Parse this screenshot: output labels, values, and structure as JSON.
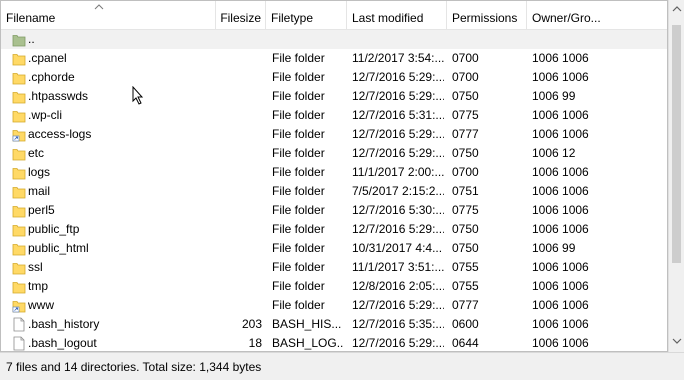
{
  "columns": {
    "filename": "Filename",
    "filesize": "Filesize",
    "filetype": "Filetype",
    "lastmodified": "Last modified",
    "permissions": "Permissions",
    "owner": "Owner/Gro..."
  },
  "icons": {
    "up": "parent-folder-icon",
    "folder": "folder-icon",
    "link": "folder-link-icon",
    "file": "file-icon"
  },
  "colors": {
    "folder": "#ffd966",
    "selection": "#f1f1f1",
    "up_folder": "#a9c08f"
  },
  "files": [
    {
      "name": "..",
      "size": "",
      "type": "",
      "modified": "",
      "perms": "",
      "owner": "",
      "icon": "up",
      "selected": true
    },
    {
      "name": ".cpanel",
      "size": "",
      "type": "File folder",
      "modified": "11/2/2017 3:54:...",
      "perms": "0700",
      "owner": "1006 1006",
      "icon": "folder"
    },
    {
      "name": ".cphorde",
      "size": "",
      "type": "File folder",
      "modified": "12/7/2016 5:29:...",
      "perms": "0700",
      "owner": "1006 1006",
      "icon": "folder"
    },
    {
      "name": ".htpasswds",
      "size": "",
      "type": "File folder",
      "modified": "12/7/2016 5:29:...",
      "perms": "0750",
      "owner": "1006 99",
      "icon": "folder"
    },
    {
      "name": ".wp-cli",
      "size": "",
      "type": "File folder",
      "modified": "12/7/2016 5:31:...",
      "perms": "0775",
      "owner": "1006 1006",
      "icon": "folder"
    },
    {
      "name": "access-logs",
      "size": "",
      "type": "File folder",
      "modified": "12/7/2016 5:29:...",
      "perms": "0777",
      "owner": "1006 1006",
      "icon": "link"
    },
    {
      "name": "etc",
      "size": "",
      "type": "File folder",
      "modified": "12/7/2016 5:29:...",
      "perms": "0750",
      "owner": "1006 12",
      "icon": "folder"
    },
    {
      "name": "logs",
      "size": "",
      "type": "File folder",
      "modified": "11/1/2017 2:00:...",
      "perms": "0700",
      "owner": "1006 1006",
      "icon": "folder"
    },
    {
      "name": "mail",
      "size": "",
      "type": "File folder",
      "modified": "7/5/2017 2:15:2...",
      "perms": "0751",
      "owner": "1006 1006",
      "icon": "folder"
    },
    {
      "name": "perl5",
      "size": "",
      "type": "File folder",
      "modified": "12/7/2016 5:30:...",
      "perms": "0775",
      "owner": "1006 1006",
      "icon": "folder"
    },
    {
      "name": "public_ftp",
      "size": "",
      "type": "File folder",
      "modified": "12/7/2016 5:29:...",
      "perms": "0750",
      "owner": "1006 1006",
      "icon": "folder"
    },
    {
      "name": "public_html",
      "size": "",
      "type": "File folder",
      "modified": "10/31/2017 4:4...",
      "perms": "0750",
      "owner": "1006 99",
      "icon": "folder"
    },
    {
      "name": "ssl",
      "size": "",
      "type": "File folder",
      "modified": "11/1/2017 3:51:...",
      "perms": "0755",
      "owner": "1006 1006",
      "icon": "folder"
    },
    {
      "name": "tmp",
      "size": "",
      "type": "File folder",
      "modified": "12/8/2016 2:05:...",
      "perms": "0755",
      "owner": "1006 1006",
      "icon": "folder"
    },
    {
      "name": "www",
      "size": "",
      "type": "File folder",
      "modified": "12/7/2016 5:29:...",
      "perms": "0777",
      "owner": "1006 1006",
      "icon": "link"
    },
    {
      "name": ".bash_history",
      "size": "203",
      "type": "BASH_HIS...",
      "modified": "12/7/2016 5:35:...",
      "perms": "0600",
      "owner": "1006 1006",
      "icon": "file"
    },
    {
      "name": ".bash_logout",
      "size": "18",
      "type": "BASH_LOG...",
      "modified": "12/7/2016 5:29:...",
      "perms": "0644",
      "owner": "1006 1006",
      "icon": "file"
    }
  ],
  "status": "7 files and 14 directories. Total size: 1,344 bytes"
}
